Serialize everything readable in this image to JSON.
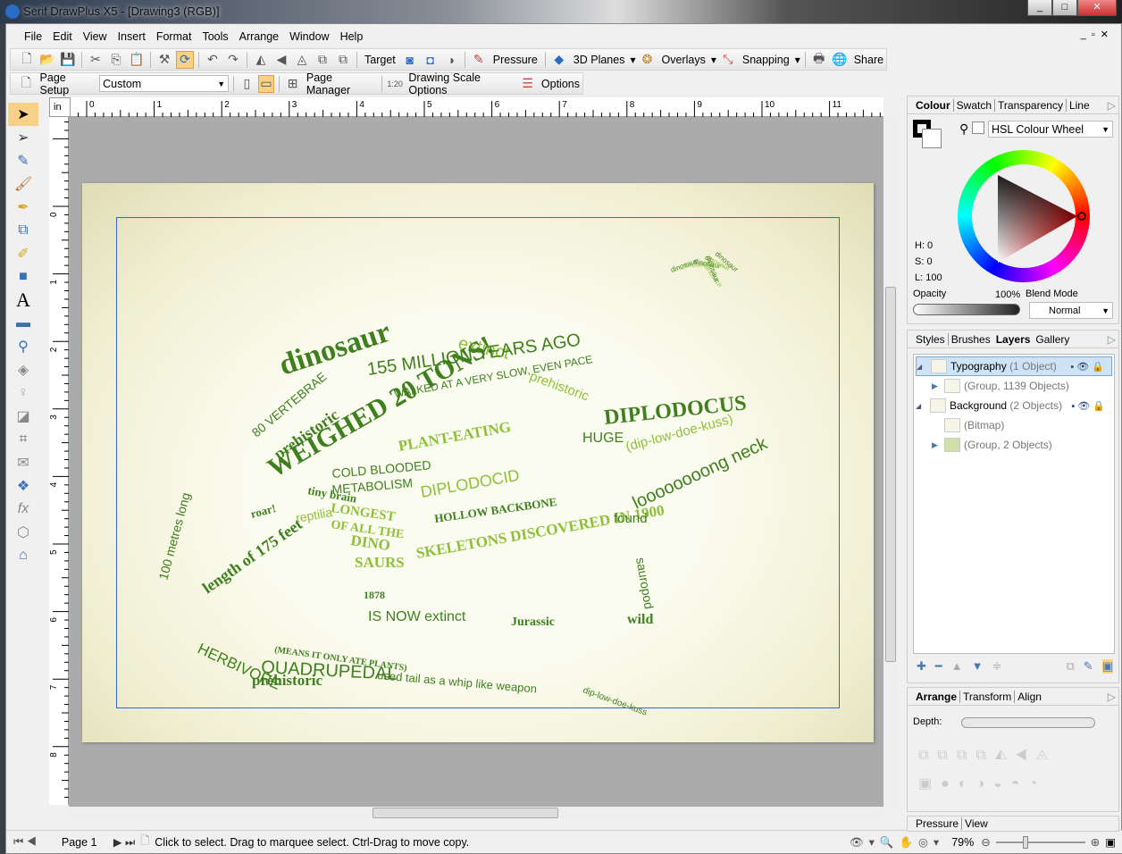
{
  "window": {
    "title": "Serif DrawPlus X5 - [Drawing3 (RGB)]",
    "controls": [
      "minimize",
      "maximize",
      "close"
    ]
  },
  "menu": [
    "File",
    "Edit",
    "View",
    "Insert",
    "Format",
    "Tools",
    "Arrange",
    "Window",
    "Help"
  ],
  "toolbar1": {
    "target": "Target",
    "pressure": "Pressure",
    "planes": "3D Planes",
    "overlays": "Overlays",
    "snapping": "Snapping",
    "share": "Share"
  },
  "toolbar2": {
    "page_setup": "Page Setup",
    "page_size": "Custom",
    "page_manager": "Page Manager",
    "drawing_scale": "Drawing Scale Options",
    "options": "Options"
  },
  "ruler": {
    "unit": "in",
    "h_ticks": [
      "0",
      "1",
      "2",
      "3",
      "4",
      "5",
      "6",
      "7",
      "8",
      "9",
      "10",
      "11"
    ],
    "v_ticks": [
      "0",
      "1",
      "2",
      "3",
      "4",
      "5",
      "6",
      "7",
      "8",
      "9"
    ]
  },
  "artwork_words": [
    "dinosaur",
    "extinct",
    "prehistoric",
    "155 MILLION YEARS AGO",
    "80 VERTEBRAE",
    "WALKED AT A VERY SLOW, EVEN PACE",
    "WEIGHED 20 TONS!",
    "DIPLODOCUS",
    "PLANT-EATING",
    "prehistoric",
    "COLD BLOODED",
    "METABOLISM",
    "LONGEST",
    "OF ALL THE",
    "DINO",
    "SAURS",
    "DIPLODOCID",
    "HOLLOW BACKBONE",
    "SKELETONS DISCOVERED IN 1900",
    "length of 175 feet",
    "HERBIVORE",
    "(MEANS IT ONLY ATE PLANTS)",
    "QUADRUPEDAL",
    "prehistoric",
    "used tail as a whip like weapon",
    "dip-low-doe-kuss",
    "HUGE",
    "(dip-low-doe-kuss)",
    "loooooooong neck",
    "found",
    "sauropod",
    "wild",
    "Jurassic",
    "IS NOW extinct",
    "100 metres long",
    "tiny brain",
    "roar!",
    "reptilia",
    "1878"
  ],
  "colour_panel": {
    "tabs": [
      "Colour",
      "Swatch",
      "Transparency",
      "Line"
    ],
    "mode": "HSL Colour Wheel",
    "h": "H: 0",
    "s": "S: 0",
    "l": "L: 100",
    "opacity_label": "Opacity",
    "opacity": "100%",
    "blend_label": "Blend Mode",
    "blend": "Normal"
  },
  "layers_panel": {
    "tabs": [
      "Styles",
      "Brushes",
      "Layers",
      "Gallery"
    ],
    "layers": [
      {
        "name": "Typography",
        "count": "(1 Object)",
        "level": 0
      },
      {
        "name": "",
        "count": "(Group, 1139 Objects)",
        "level": 1
      },
      {
        "name": "Background",
        "count": "(2 Objects)",
        "level": 0
      },
      {
        "name": "",
        "count": "(Bitmap)",
        "level": 1
      },
      {
        "name": "",
        "count": "(Group, 2 Objects)",
        "level": 1
      }
    ]
  },
  "arrange_panel": {
    "tabs": [
      "Arrange",
      "Transform",
      "Align"
    ],
    "depth_label": "Depth:"
  },
  "pressure_panel": {
    "tabs": [
      "Pressure",
      "View"
    ]
  },
  "status": {
    "page": "Page 1",
    "hint": "Click to select. Drag to marquee select. Ctrl-Drag to move copy.",
    "zoom": "79%"
  },
  "colors": {
    "accent": "#3a66c4",
    "word_dark": "#3f7f1e",
    "word_light": "#8fbf3a"
  }
}
